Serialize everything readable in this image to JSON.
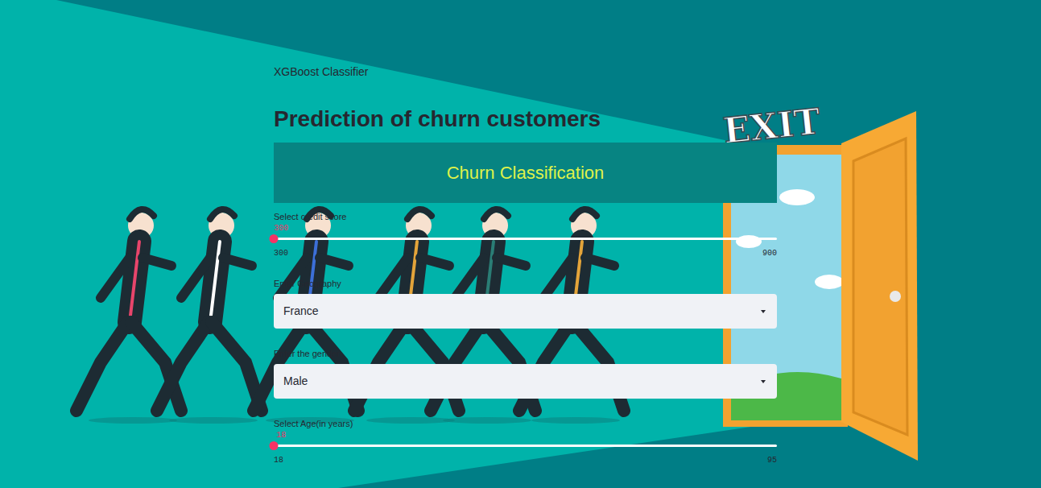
{
  "app": {
    "subtitle": "XGBoost Classifier",
    "title": "Prediction of churn customers",
    "banner": "Churn Classification"
  },
  "background": {
    "sign": "EXIT"
  },
  "controls": [
    {
      "kind": "slider",
      "label": "Select credit score",
      "value": "300",
      "min": "300",
      "max": "900",
      "level": 0
    },
    {
      "kind": "select",
      "label": "Enter Geography",
      "value": "France"
    },
    {
      "kind": "select",
      "label": "Enter the gender",
      "value": "Male"
    },
    {
      "kind": "slider",
      "label": "Select Age(in years)",
      "value": "18",
      "min": "18",
      "max": "95",
      "level": 0
    }
  ]
}
